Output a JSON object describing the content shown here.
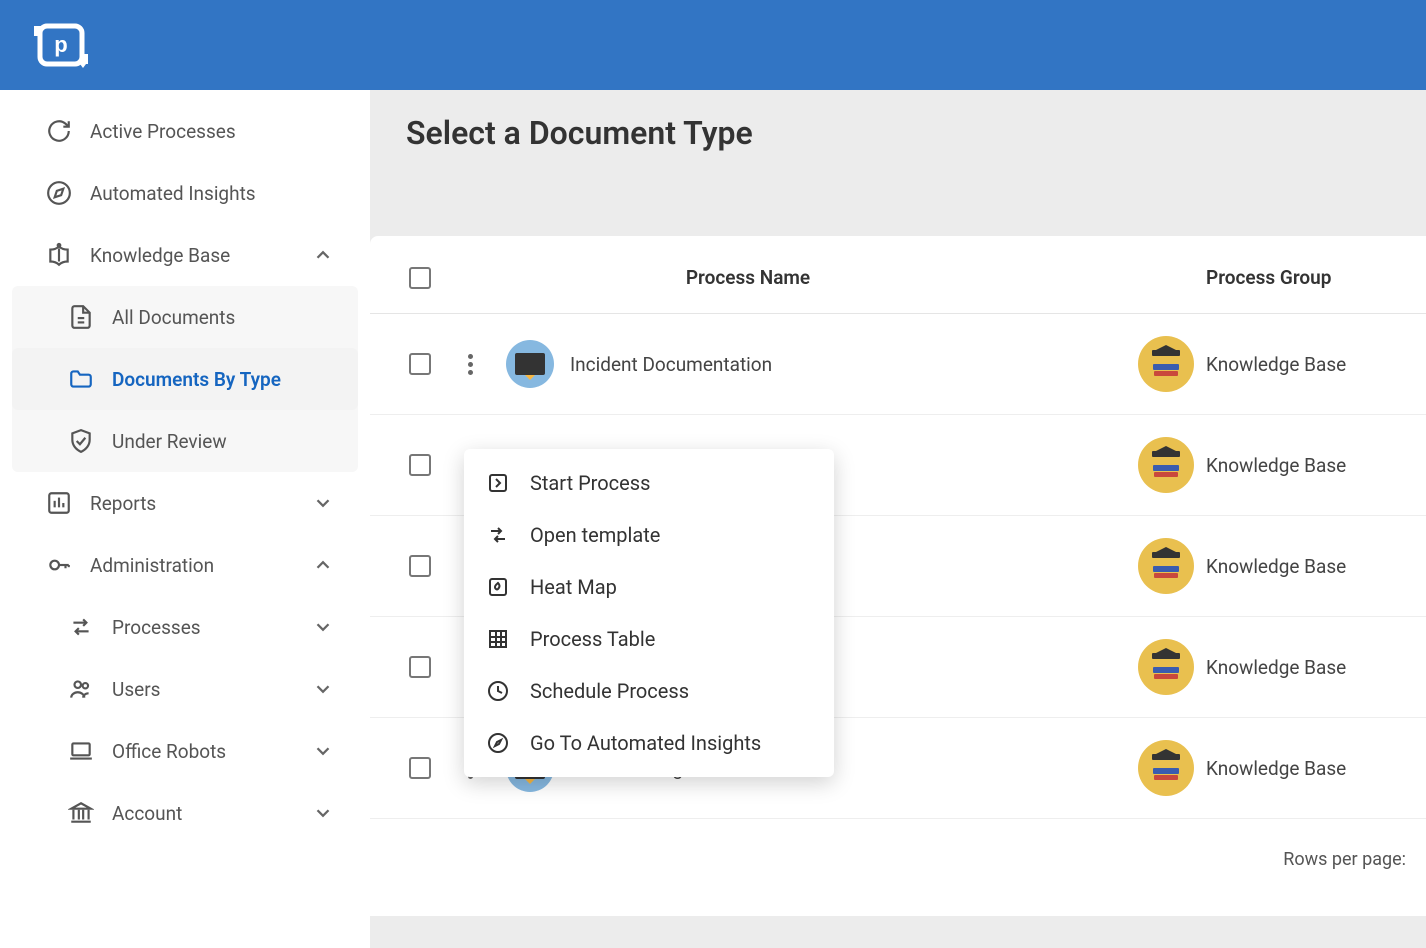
{
  "header": {},
  "page_title": "Select a Document Type",
  "sidebar": {
    "items": [
      {
        "label": "Active Processes"
      },
      {
        "label": "Automated Insights"
      },
      {
        "label": "Knowledge Base",
        "expanded": true,
        "children": [
          {
            "label": "All Documents"
          },
          {
            "label": "Documents By Type",
            "active": true
          },
          {
            "label": "Under Review"
          }
        ]
      },
      {
        "label": "Reports",
        "expanded": false
      },
      {
        "label": "Administration",
        "expanded": true,
        "children": [
          {
            "label": "Processes"
          },
          {
            "label": "Users"
          },
          {
            "label": "Office Robots"
          },
          {
            "label": "Account"
          }
        ]
      }
    ]
  },
  "table": {
    "columns": {
      "name": "Process Name",
      "group": "Process Group"
    },
    "rows": [
      {
        "name": "Incident Documentation",
        "group": "Knowledge Base"
      },
      {
        "name": "",
        "group": "Knowledge Base"
      },
      {
        "name": "",
        "group": "Knowledge Base"
      },
      {
        "name": "",
        "group": "Knowledge Base"
      },
      {
        "name": "Server Configuration",
        "group": "Knowledge Base"
      }
    ],
    "footer": "Rows per page:"
  },
  "context_menu": {
    "items": [
      {
        "label": "Start Process"
      },
      {
        "label": "Open template"
      },
      {
        "label": "Heat Map"
      },
      {
        "label": "Process Table"
      },
      {
        "label": "Schedule Process"
      },
      {
        "label": "Go To Automated Insights"
      }
    ]
  }
}
